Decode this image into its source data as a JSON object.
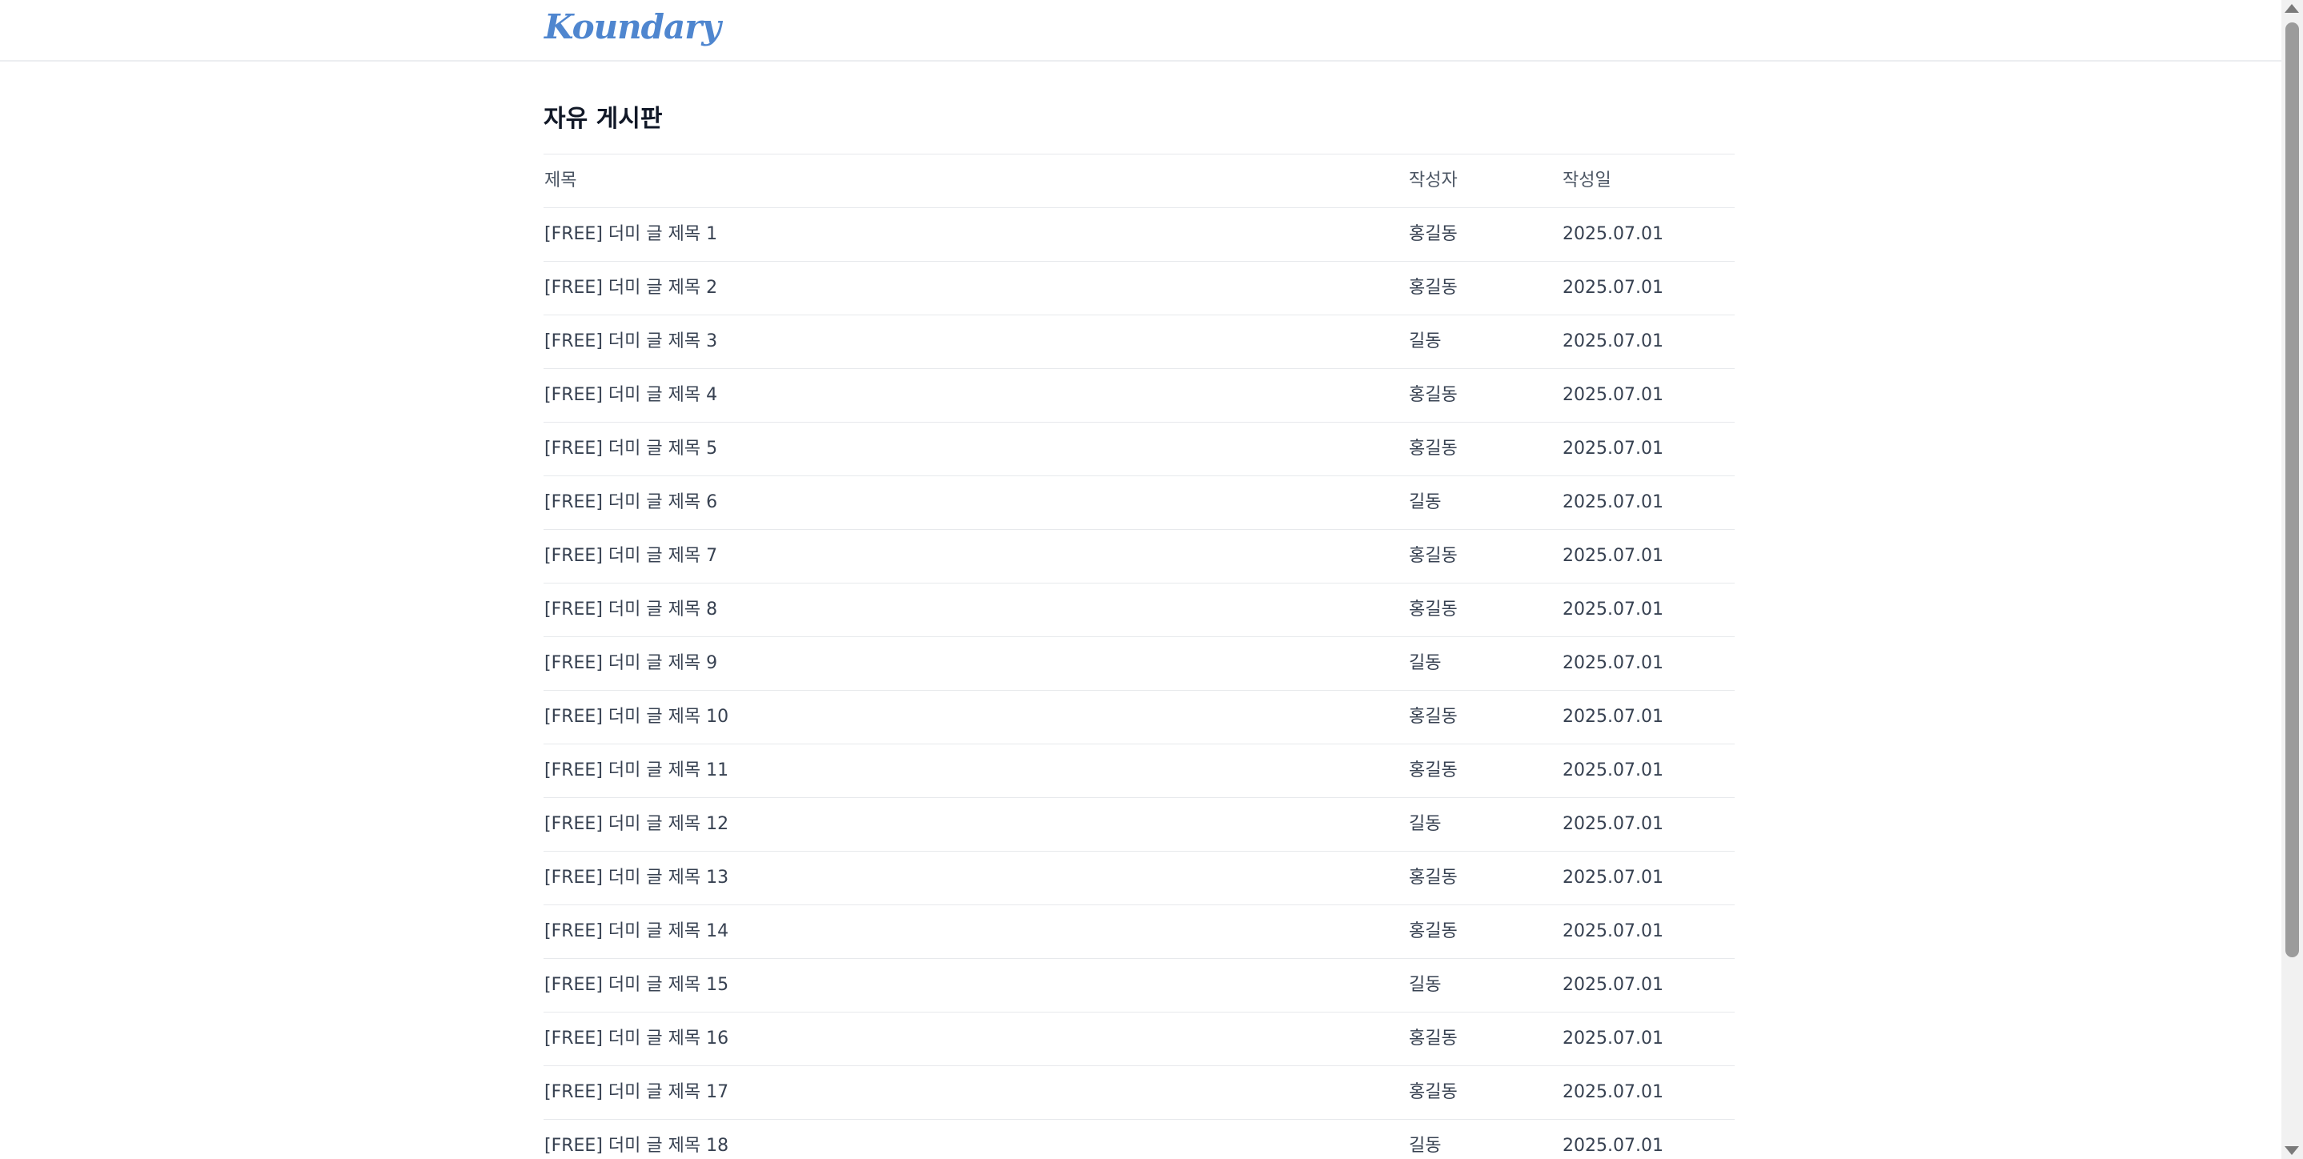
{
  "header": {
    "logo_text": "Koundary"
  },
  "board": {
    "title": "자유 게시판",
    "columns": {
      "title": "제목",
      "author": "작성자",
      "date": "작성일"
    },
    "posts": [
      {
        "title": "[FREE] 더미 글 제목 1",
        "author": "홍길동",
        "date": "2025.07.01"
      },
      {
        "title": "[FREE] 더미 글 제목 2",
        "author": "홍길동",
        "date": "2025.07.01"
      },
      {
        "title": "[FREE] 더미 글 제목 3",
        "author": "길동",
        "date": "2025.07.01"
      },
      {
        "title": "[FREE] 더미 글 제목 4",
        "author": "홍길동",
        "date": "2025.07.01"
      },
      {
        "title": "[FREE] 더미 글 제목 5",
        "author": "홍길동",
        "date": "2025.07.01"
      },
      {
        "title": "[FREE] 더미 글 제목 6",
        "author": "길동",
        "date": "2025.07.01"
      },
      {
        "title": "[FREE] 더미 글 제목 7",
        "author": "홍길동",
        "date": "2025.07.01"
      },
      {
        "title": "[FREE] 더미 글 제목 8",
        "author": "홍길동",
        "date": "2025.07.01"
      },
      {
        "title": "[FREE] 더미 글 제목 9",
        "author": "길동",
        "date": "2025.07.01"
      },
      {
        "title": "[FREE] 더미 글 제목 10",
        "author": "홍길동",
        "date": "2025.07.01"
      },
      {
        "title": "[FREE] 더미 글 제목 11",
        "author": "홍길동",
        "date": "2025.07.01"
      },
      {
        "title": "[FREE] 더미 글 제목 12",
        "author": "길동",
        "date": "2025.07.01"
      },
      {
        "title": "[FREE] 더미 글 제목 13",
        "author": "홍길동",
        "date": "2025.07.01"
      },
      {
        "title": "[FREE] 더미 글 제목 14",
        "author": "홍길동",
        "date": "2025.07.01"
      },
      {
        "title": "[FREE] 더미 글 제목 15",
        "author": "길동",
        "date": "2025.07.01"
      },
      {
        "title": "[FREE] 더미 글 제목 16",
        "author": "홍길동",
        "date": "2025.07.01"
      },
      {
        "title": "[FREE] 더미 글 제목 17",
        "author": "홍길동",
        "date": "2025.07.01"
      },
      {
        "title": "[FREE] 더미 글 제목 18",
        "author": "길동",
        "date": "2025.07.01"
      }
    ]
  },
  "colors": {
    "logo": "#4f86cf",
    "text": "#374151",
    "divider": "#e7e9ec"
  },
  "icons": {
    "scroll_up": "chevron-up-icon",
    "scroll_down": "chevron-down-icon"
  }
}
